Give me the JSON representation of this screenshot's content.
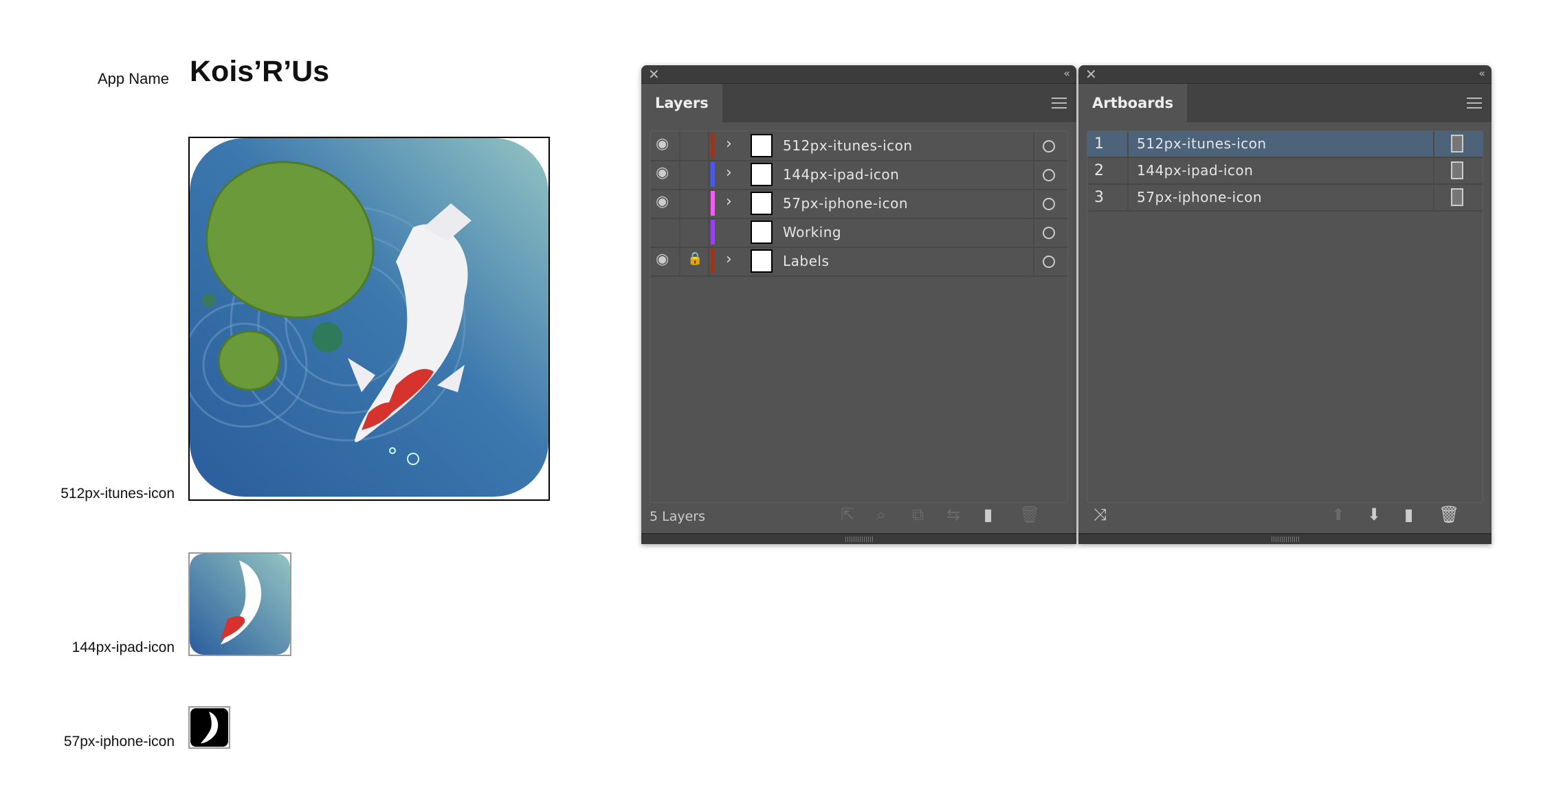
{
  "canvas": {
    "app_name_label": "App Name",
    "app_name": "Kois’R’Us",
    "artboards": [
      {
        "label": "512px-itunes-icon"
      },
      {
        "label": "144px-ipad-icon"
      },
      {
        "label": "57px-iphone-icon"
      }
    ]
  },
  "layers_panel": {
    "tab": "Layers",
    "close_icon": "close-icon",
    "collapse_icon": "double-chevron-left-icon",
    "layers": [
      {
        "name": "512px-itunes-icon",
        "visible": true,
        "locked": false,
        "expandable": true,
        "color": "#a0341a"
      },
      {
        "name": "144px-ipad-icon",
        "visible": true,
        "locked": false,
        "expandable": true,
        "color": "#4a55ff"
      },
      {
        "name": "57px-iphone-icon",
        "visible": true,
        "locked": false,
        "expandable": true,
        "color": "#ff55ff"
      },
      {
        "name": "Working",
        "visible": false,
        "locked": false,
        "expandable": false,
        "color": "#9b3cff"
      },
      {
        "name": "Labels",
        "visible": true,
        "locked": true,
        "expandable": true,
        "color": "#a0341a"
      }
    ],
    "footer": "5 Layers",
    "footer_icons": [
      "export-icon",
      "search-icon",
      "clipping-mask-icon",
      "move-to-layer-icon",
      "new-layer-icon",
      "trash-icon"
    ]
  },
  "artboards_panel": {
    "tab": "Artboards",
    "selected_index": 0,
    "items": [
      {
        "number": "1",
        "name": "512px-itunes-icon"
      },
      {
        "number": "2",
        "name": "144px-ipad-icon"
      },
      {
        "number": "3",
        "name": "57px-iphone-icon"
      }
    ],
    "footer_icons": [
      "rearrange-icon",
      "move-up-icon",
      "move-down-icon",
      "new-artboard-icon",
      "trash-icon"
    ]
  }
}
